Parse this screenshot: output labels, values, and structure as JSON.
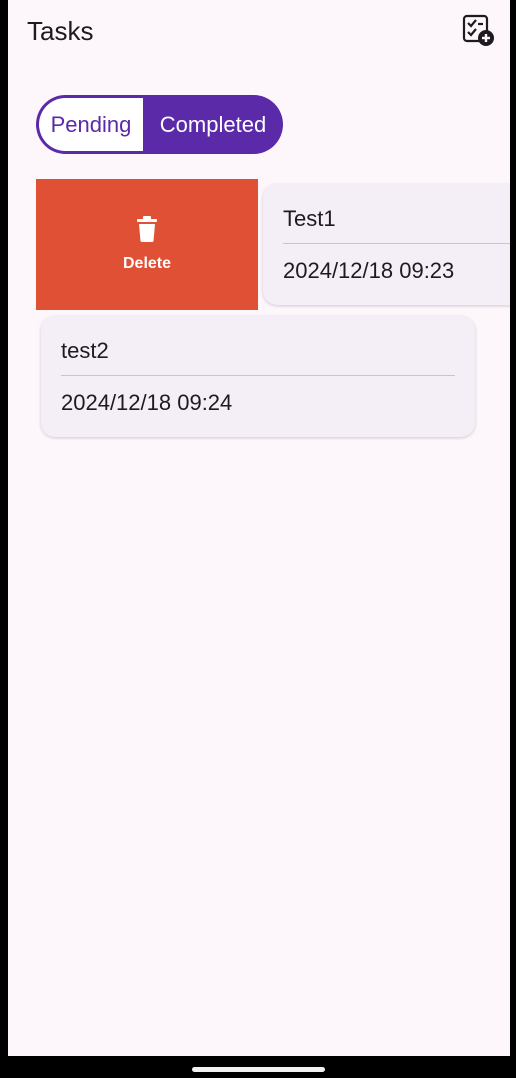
{
  "app": {
    "title": "Tasks",
    "add_icon": "add-task-icon"
  },
  "tabs": {
    "pending": "Pending",
    "completed": "Completed",
    "selected": "Pending"
  },
  "swipe_action": {
    "label": "Delete",
    "icon": "trash-icon",
    "color": "#e05035"
  },
  "tasks": [
    {
      "title": "Test1",
      "date": "2024/12/18 09:23"
    },
    {
      "title": "test2",
      "date": "2024/12/18 09:24"
    }
  ],
  "colors": {
    "accent": "#5b2aa8",
    "background": "#fdf6fb",
    "card": "#f4eef6"
  }
}
